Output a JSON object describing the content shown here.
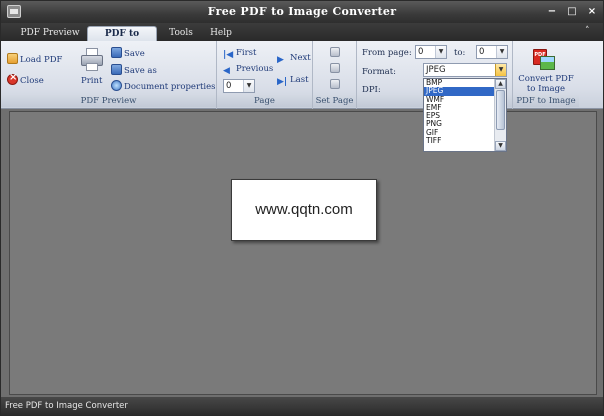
{
  "window": {
    "title": "Free PDF to Image Converter"
  },
  "tabs": [
    {
      "label": "PDF Preview"
    },
    {
      "label": "PDF to Image"
    },
    {
      "label": "Tools"
    },
    {
      "label": "Help"
    }
  ],
  "ribbon": {
    "pdf_preview": {
      "group_label": "PDF Preview",
      "load_pdf": "Load PDF",
      "close": "Close",
      "print": "Print",
      "save": "Save",
      "save_as": "Save as",
      "document_properties": "Document properties"
    },
    "page": {
      "group_label": "Page",
      "first": "First",
      "previous": "Previous",
      "next": "Next",
      "last": "Last",
      "page_value": "0"
    },
    "set_page": {
      "group_label": "Set Page"
    },
    "settings": {
      "group_label": "Se",
      "from_page_label": "From page:",
      "from_page_value": "0",
      "to_label": "to:",
      "to_value": "0",
      "format_label": "Format:",
      "format_value": "JPEG",
      "dpi_label": "DPI:"
    },
    "convert": {
      "group_label": "PDF to Image",
      "button_label_line1": "Convert PDF",
      "button_label_line2": "to Image"
    }
  },
  "format_dropdown": {
    "options": [
      "BMP",
      "JPEG",
      "WMF",
      "EMF",
      "EPS",
      "PNG",
      "GIF",
      "TIFF"
    ],
    "selected": "JPEG"
  },
  "watermark": {
    "text": "www.qqtn.com"
  },
  "statusbar": {
    "text": "Free PDF to Image Converter"
  }
}
